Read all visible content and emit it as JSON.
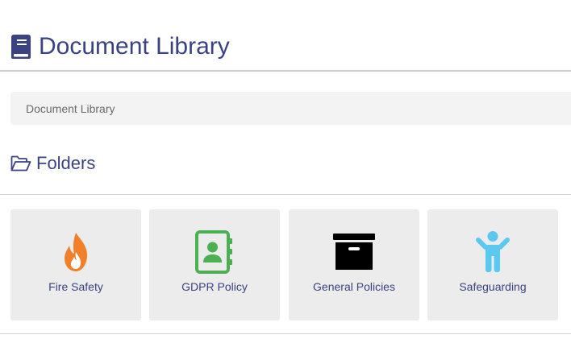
{
  "header": {
    "title": "Document Library",
    "title_icon": "book-icon",
    "accent_color": "#3b4282"
  },
  "breadcrumb": {
    "items": [
      "Document Library"
    ]
  },
  "folders_section": {
    "title": "Folders",
    "icon": "folder-open-icon",
    "folders": [
      {
        "label": "Fire Safety",
        "icon": "flame-icon",
        "icon_color": "#f0802a"
      },
      {
        "label": "GDPR Policy",
        "icon": "address-book-icon",
        "icon_color": "#4caf50"
      },
      {
        "label": "General Policies",
        "icon": "archive-box-icon",
        "icon_color": "#000000"
      },
      {
        "label": "Safeguarding",
        "icon": "child-icon",
        "icon_color": "#5bc8ef"
      }
    ]
  }
}
